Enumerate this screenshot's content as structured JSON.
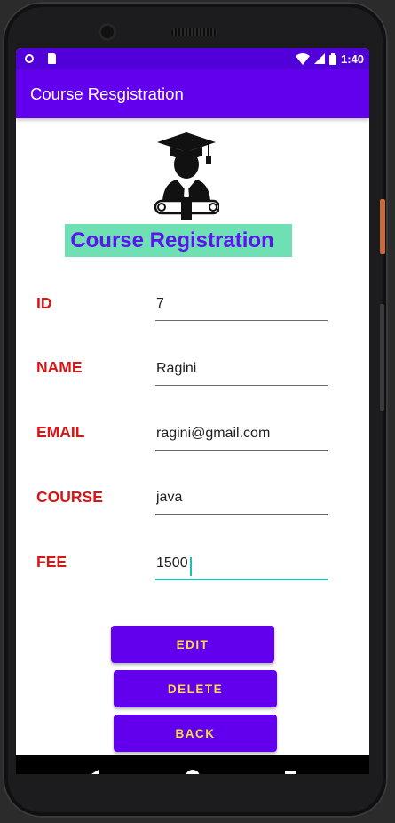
{
  "status_bar": {
    "time": "1:40"
  },
  "app_bar": {
    "title": "Course Resgistration"
  },
  "heading": "Course Registration",
  "form": {
    "fields": [
      {
        "label": "ID",
        "value": "7"
      },
      {
        "label": "NAME",
        "value": "Ragini"
      },
      {
        "label": "EMAIL",
        "value": "ragini@gmail.com"
      },
      {
        "label": "COURSE",
        "value": "java"
      },
      {
        "label": "FEE",
        "value": "1500"
      }
    ]
  },
  "buttons": {
    "edit": "EDIT",
    "delete": "DELETE",
    "back": "BACK"
  },
  "icons": {
    "graduate_logo": "graduate-logo-icon",
    "nav_back": "back-triangle-icon",
    "nav_home": "home-circle-icon",
    "nav_recents": "recents-square-icon"
  },
  "colors": {
    "app_bar": "#6200ee",
    "status_bar": "#5200d9",
    "label_red": "#d91616",
    "heading_bg": "#6fdfb4",
    "heading_text": "#5b14ee",
    "button_text": "#f6dc3c",
    "focus_teal": "#1cc0b0"
  }
}
